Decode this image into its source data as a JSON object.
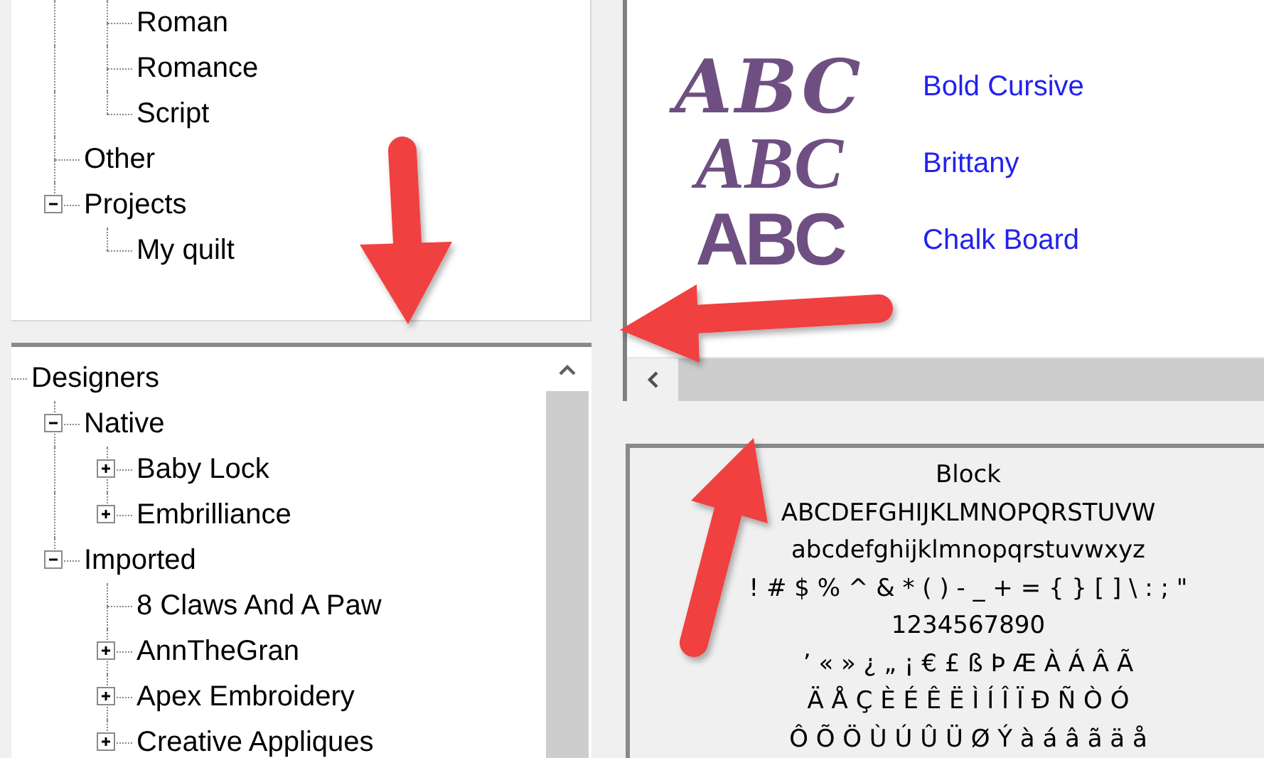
{
  "top_tree": {
    "continued": [
      {
        "label": "Roman"
      },
      {
        "label": "Romance"
      },
      {
        "label": "Script"
      }
    ],
    "items": [
      {
        "label": "Other"
      },
      {
        "label": "Projects",
        "expanded": true,
        "children": [
          {
            "label": "My quilt"
          }
        ]
      }
    ]
  },
  "bottom_tree": {
    "items": [
      {
        "label": "Designers",
        "children": [
          {
            "label": "Native",
            "expanded": true,
            "children": [
              {
                "label": "Baby Lock",
                "expanded": false
              },
              {
                "label": "Embrilliance",
                "expanded": false
              }
            ]
          },
          {
            "label": "Imported",
            "expanded": true,
            "children": [
              {
                "label": "8 Claws And A Paw"
              },
              {
                "label": "AnnTheGran",
                "expanded": false
              },
              {
                "label": "Apex Embroidery",
                "expanded": false
              },
              {
                "label": "Creative Appliques",
                "expanded": false
              }
            ]
          }
        ]
      }
    ]
  },
  "font_list": [
    {
      "kind": "cursive",
      "sample": "ABC",
      "label": "Bold Cursive"
    },
    {
      "kind": "script",
      "sample": "ABC",
      "label": "Brittany"
    },
    {
      "kind": "block",
      "sample": "ABC",
      "label": "Chalk Board"
    }
  ],
  "preview": {
    "title": "Block",
    "lines": [
      "ABCDEFGHIJKLMNOPQRSTUVW",
      "abcdefghijklmnopqrstuvwxyz",
      "! # $ % ^ & * ( ) - _ + = { } [ ] \\ : ; \"",
      "1234567890",
      "’ « » ¿ „ ¡ € £ ß Þ Æ À Á Â Ã",
      "Ä Å Ç È É Ê Ë Ì Í Î Ï Ð Ñ Ò Ó",
      "Ô Õ Ö Ù Ú Û Ü Ø Ý à á â ã ä å"
    ]
  }
}
